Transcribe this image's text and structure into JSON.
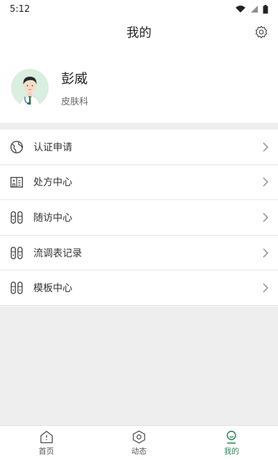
{
  "status_bar": {
    "time": "5:12",
    "icons": [
      "wifi-icon",
      "signal-icon",
      "battery-icon"
    ]
  },
  "header": {
    "title": "我的",
    "settings_icon": "gear-icon"
  },
  "profile": {
    "name": "彭威",
    "department": "皮肤科",
    "avatar_icon": "doctor-avatar"
  },
  "menu": [
    {
      "label": "认证申请",
      "icon": "globe-icon"
    },
    {
      "label": "处方中心",
      "icon": "building-icon"
    },
    {
      "label": "随访中心",
      "icon": "list-icon"
    },
    {
      "label": "流调表记录",
      "icon": "list-icon"
    },
    {
      "label": "模板中心",
      "icon": "list-icon"
    }
  ],
  "tabs": [
    {
      "label": "首页",
      "icon": "home-icon",
      "active": false
    },
    {
      "label": "动态",
      "icon": "hexagon-icon",
      "active": false
    },
    {
      "label": "我的",
      "icon": "profile-icon",
      "active": true
    }
  ],
  "colors": {
    "accent": "#2a8a5a",
    "background_gray": "#eeeeee"
  }
}
